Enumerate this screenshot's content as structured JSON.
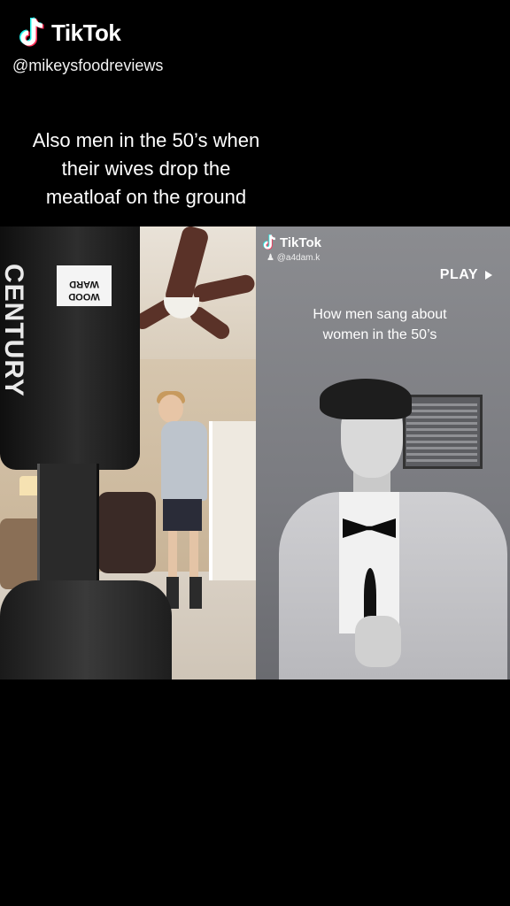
{
  "watermark": {
    "brand": "TikTok",
    "handle": "@mikeysfoodreviews",
    "icon": "tiktok-logo-icon"
  },
  "caption": {
    "lines": [
      "Also men in the 50’s when",
      "their wives drop the",
      "meatloaf on the ground"
    ]
  },
  "duet": {
    "left": {
      "bag_label": "WOOD WARD",
      "bag_brand": "CENTURY"
    },
    "right": {
      "watermark": {
        "brand": "TikTok",
        "handle": "@a4dam.k"
      },
      "play_label": "PLAY",
      "caption_lines": [
        "How men sang about",
        "women in the 50’s"
      ]
    }
  },
  "colors": {
    "background": "#000000",
    "text": "#ffffff",
    "logo_cyan": "#25f4ee",
    "logo_red": "#fe2c55"
  }
}
